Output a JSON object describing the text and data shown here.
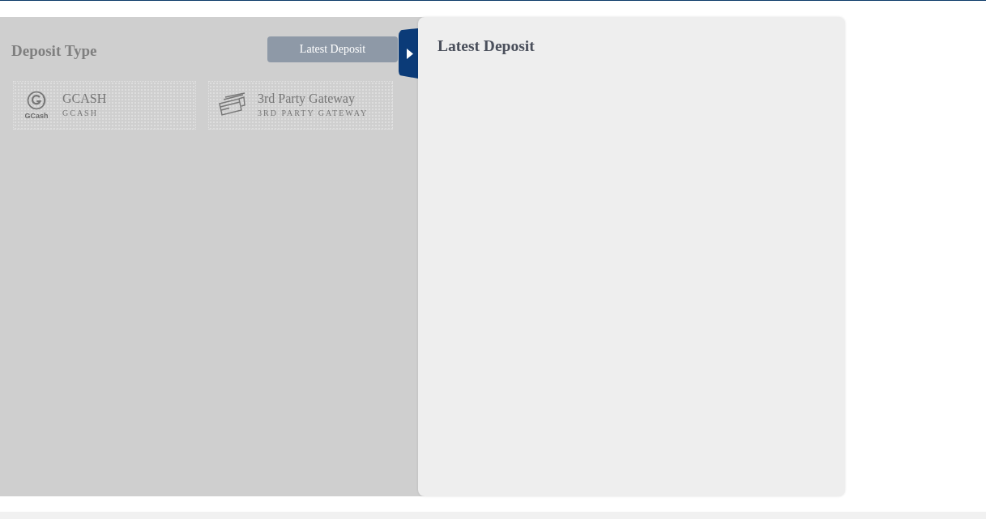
{
  "deposit_panel": {
    "title": "Deposit Type",
    "latest_button": "Latest Deposit",
    "methods": [
      {
        "kind": "gcash",
        "logo_text": "GCash",
        "name": "GCASH",
        "code": "GCASH"
      },
      {
        "kind": "gateway",
        "name": "3rd Party Gateway",
        "code": "3RD PARTY GATEWAY"
      }
    ]
  },
  "drawer": {
    "open": true,
    "title": "Latest Deposit"
  }
}
